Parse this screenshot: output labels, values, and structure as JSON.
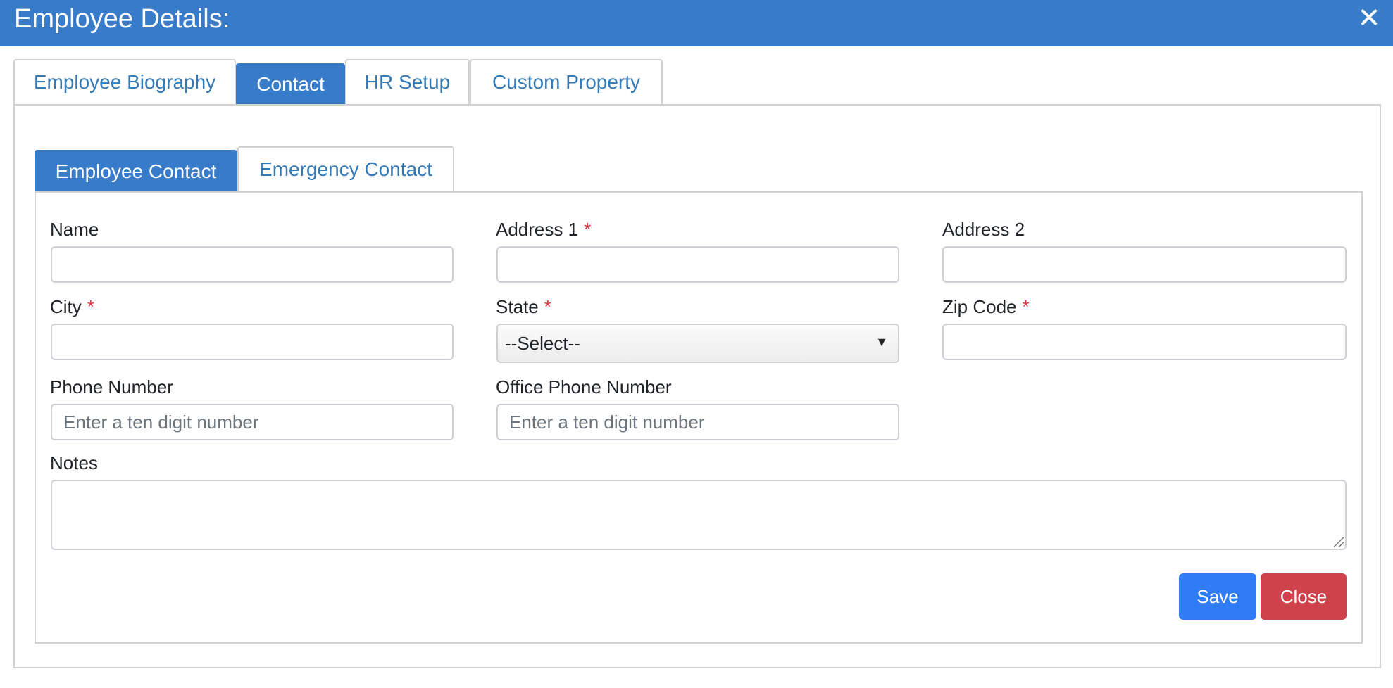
{
  "dialog": {
    "title": "Employee Details:",
    "close_icon": "close-icon"
  },
  "main_tabs": [
    {
      "label": "Employee Biography",
      "active": false
    },
    {
      "label": "Contact",
      "active": true
    },
    {
      "label": "HR Setup",
      "active": false
    },
    {
      "label": "Custom Property",
      "active": false
    }
  ],
  "sub_tabs": [
    {
      "label": "Employee Contact",
      "active": true
    },
    {
      "label": "Emergency Contact",
      "active": false
    }
  ],
  "form": {
    "name": {
      "label": "Name",
      "value": ""
    },
    "address1": {
      "label": "Address 1",
      "required_mark": "*",
      "value": ""
    },
    "address2": {
      "label": "Address 2",
      "value": ""
    },
    "city": {
      "label": "City",
      "required_mark": "*",
      "value": ""
    },
    "state": {
      "label": "State",
      "required_mark": "*",
      "selected": "--Select--"
    },
    "zip": {
      "label": "Zip Code",
      "required_mark": "*",
      "value": ""
    },
    "phone": {
      "label": "Phone Number",
      "placeholder": "Enter a ten digit number",
      "value": ""
    },
    "office_phone": {
      "label": "Office Phone Number",
      "placeholder": "Enter a ten digit number",
      "value": ""
    },
    "notes": {
      "label": "Notes",
      "value": ""
    }
  },
  "actions": {
    "save_label": "Save",
    "close_label": "Close"
  },
  "colors": {
    "header_blue": "#377bc9",
    "link_blue": "#337ab7",
    "save_blue": "#2f7cf6",
    "close_red": "#d0424b",
    "required_red": "#dc3545"
  }
}
